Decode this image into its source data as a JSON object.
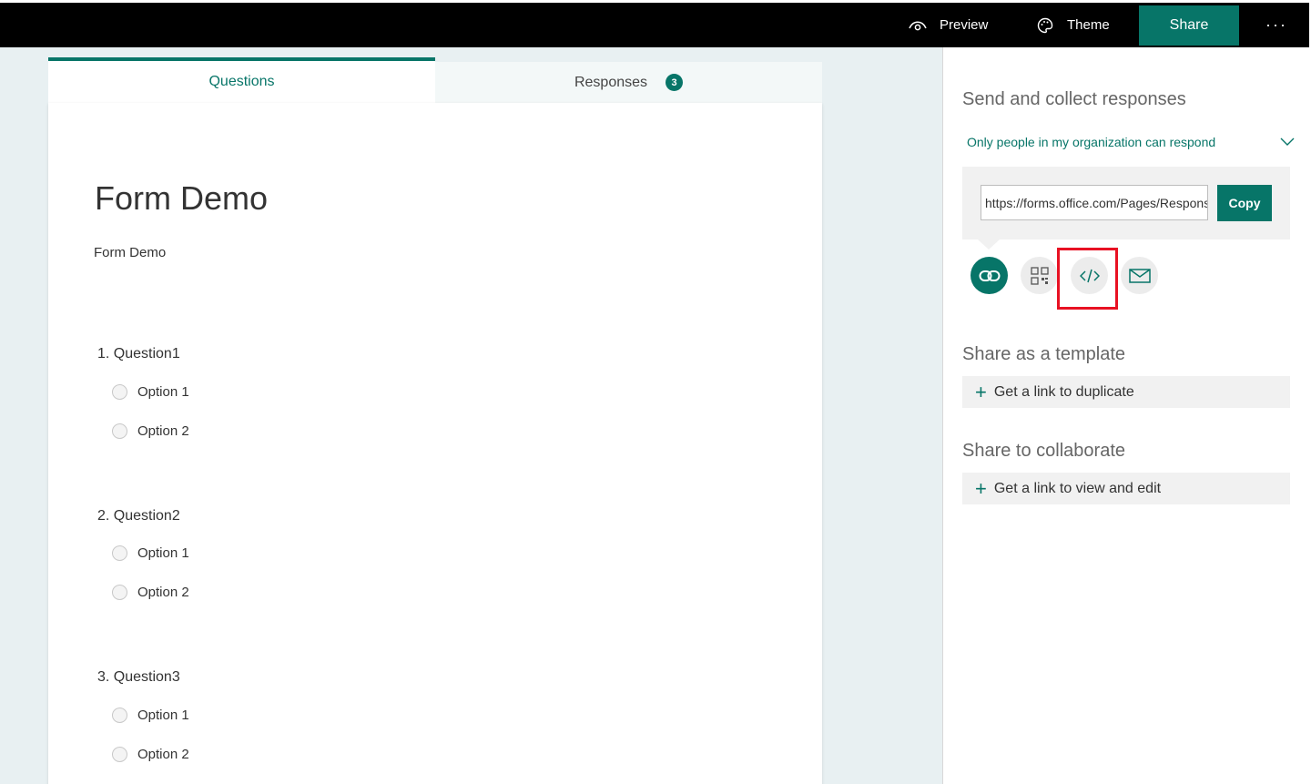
{
  "topbar": {
    "preview_label": "Preview",
    "theme_label": "Theme",
    "share_label": "Share",
    "more_label": "···"
  },
  "tabs": {
    "questions_label": "Questions",
    "responses_label": "Responses",
    "responses_count": "3"
  },
  "form": {
    "title": "Form Demo",
    "description": "Form Demo",
    "questions": [
      {
        "label": "1. Question1",
        "options": [
          "Option 1",
          "Option 2"
        ]
      },
      {
        "label": "2. Question2",
        "options": [
          "Option 1",
          "Option 2"
        ]
      },
      {
        "label": "3. Question3",
        "options": [
          "Option 1",
          "Option 2"
        ]
      }
    ]
  },
  "share_pane": {
    "heading": "Send and collect responses",
    "audience": "Only people in my organization can respond",
    "link_value": "https://forms.office.com/Pages/ResponsePage.aspx",
    "copy_label": "Copy",
    "icons": [
      "link-icon",
      "qr-code-icon",
      "embed-code-icon",
      "email-icon"
    ],
    "template_heading": "Share as a template",
    "template_action": "Get a link to duplicate",
    "collab_heading": "Share to collaborate",
    "collab_action": "Get a link to view and edit"
  },
  "colors": {
    "accent": "#077568",
    "highlight": "#e81123",
    "topbar": "#000000",
    "canvas": "#e8f0f2"
  }
}
